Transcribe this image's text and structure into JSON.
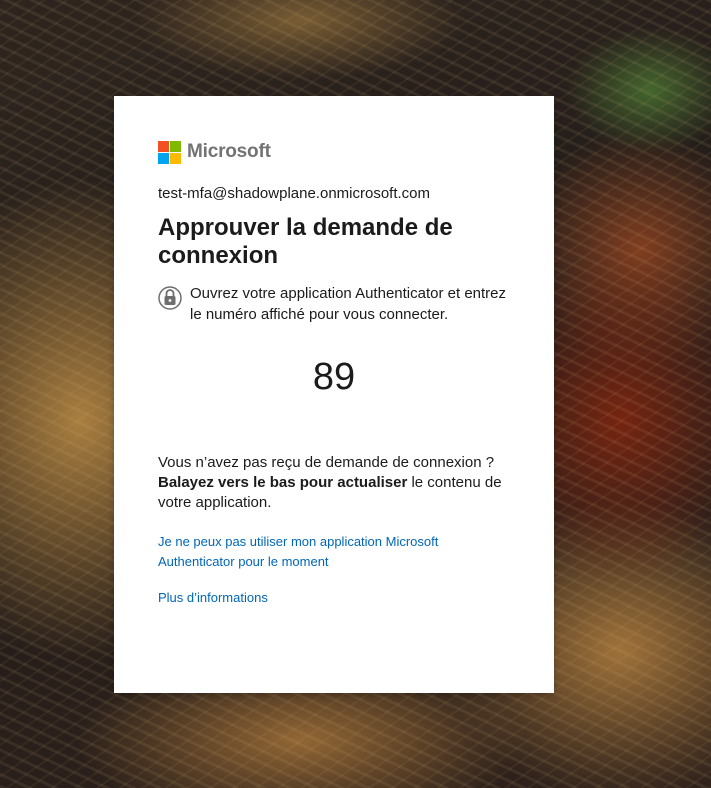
{
  "brand": {
    "name": "Microsoft",
    "logo_colors": [
      "#f25022",
      "#7fba00",
      "#00a4ef",
      "#ffb900"
    ]
  },
  "identity": "test-mfa@shadowplane.onmicrosoft.com",
  "title": "Approuver la demande de connexion",
  "instruction": {
    "icon": "lock-icon",
    "text": "Ouvrez votre application Authenticator et entrez le numéro affiché pour vous connecter."
  },
  "code": "89",
  "help": {
    "line1": "Vous n’avez pas reçu de demande de connexion ?",
    "bold": "Balayez vers le bas pour actualiser",
    "rest": " le contenu de votre application."
  },
  "links": {
    "cant_use_app": "Je ne peux pas utiliser mon application Microsoft Authenticator pour le moment",
    "more_info": "Plus d’informations"
  },
  "colors": {
    "link": "#0067b8",
    "text": "#1b1b1b",
    "brand_text": "#737373"
  }
}
